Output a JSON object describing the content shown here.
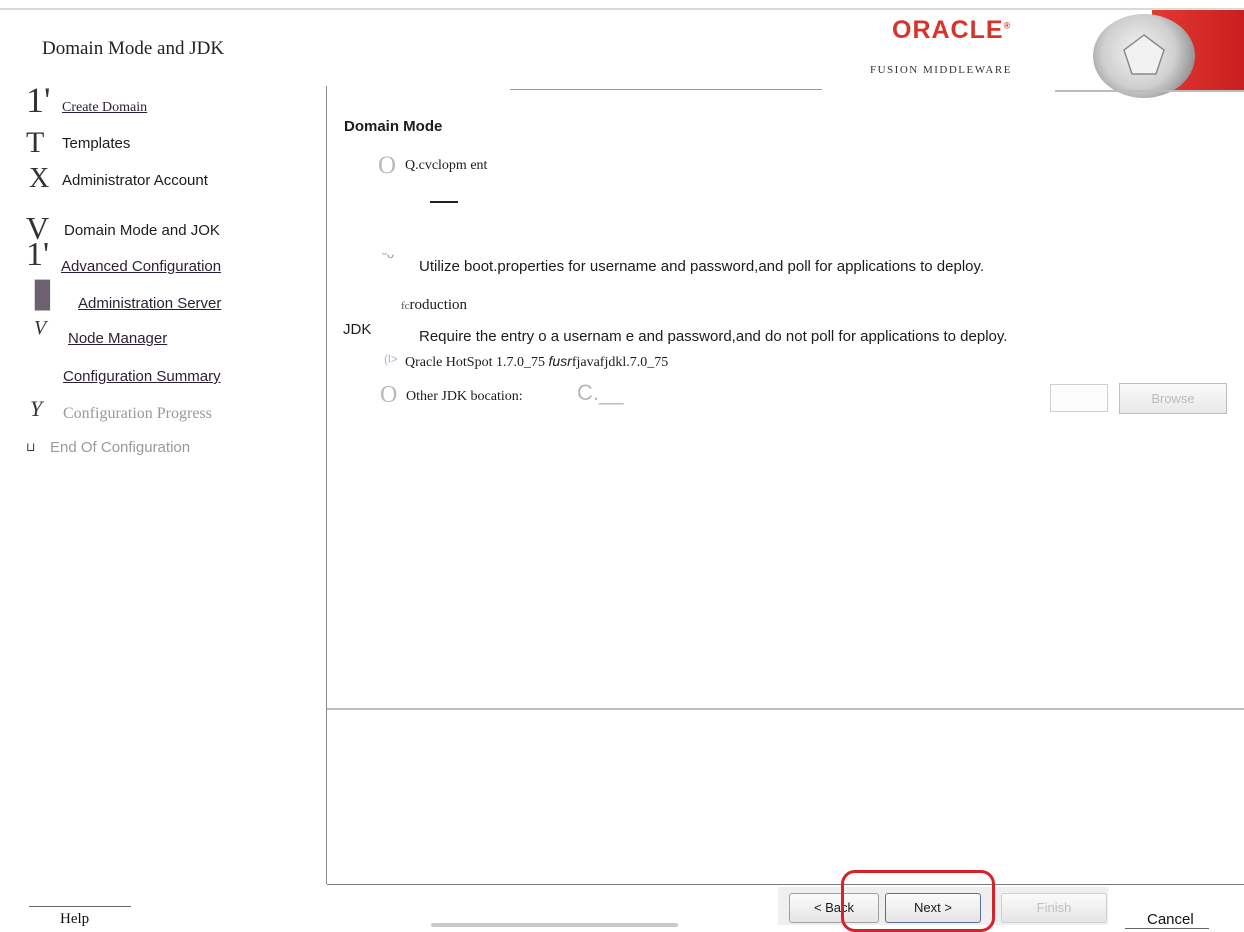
{
  "header": {
    "title": "Domain Mode and JDK",
    "logo_text": "ORACLE",
    "logo_mark": "®",
    "subtitle": "FUSION MIDDLEWARE",
    "brand_color": "#d8342b",
    "emblem_icon": "pentagon-emblem-icon"
  },
  "sidebar": {
    "items": [
      {
        "glyph": "1'",
        "label": "Create Domain"
      },
      {
        "glyph": "T",
        "label": "Templates"
      },
      {
        "glyph": "X",
        "label": "Administrator Account"
      },
      {
        "glyph": "V",
        "label": "Domain Mode and JOK"
      },
      {
        "glyph": "1'",
        "label": "Advanced Configuration"
      },
      {
        "glyph": "▊",
        "label": "Administration Server"
      },
      {
        "glyph": "V",
        "label": "Node Manager"
      },
      {
        "glyph": "",
        "label": "Configuration Summary"
      },
      {
        "glyph": "Y",
        "label": "Configuration Progress"
      },
      {
        "glyph": "⊔",
        "label": "End Of Configuration"
      }
    ]
  },
  "domain_mode": {
    "header": "Domain Mode",
    "development": {
      "radio_glyph": "O",
      "label": "Q.cvclopm ent",
      "selected_icon": "ᵕᴗ",
      "description": "Utilize boot.properties for username  and password,and poll for applications to deploy."
    },
    "production": {
      "label_prefix": "fc",
      "label": "roduction",
      "description": "Require the entry  o  a usernam e and password,and do not poll for applications to deploy."
    }
  },
  "jdk": {
    "header": "JDK",
    "current_icon": "(l>",
    "current_prefix": "Qracle  HotSpot 1.7.0_75 ",
    "current_italic": "fusr",
    "current_suffix": "fjavafjdkl.7.0_75",
    "other_radio_glyph": "O",
    "other_label": "Other JDK bocation:",
    "other_path": "C.__",
    "browse_label": "Browse"
  },
  "footer": {
    "help_label": "Help",
    "back_label": "< Back",
    "next_label": "Next >",
    "finish_label": "Finish",
    "cancel_label": "Cancel",
    "highlight_color": "#d6232a"
  }
}
